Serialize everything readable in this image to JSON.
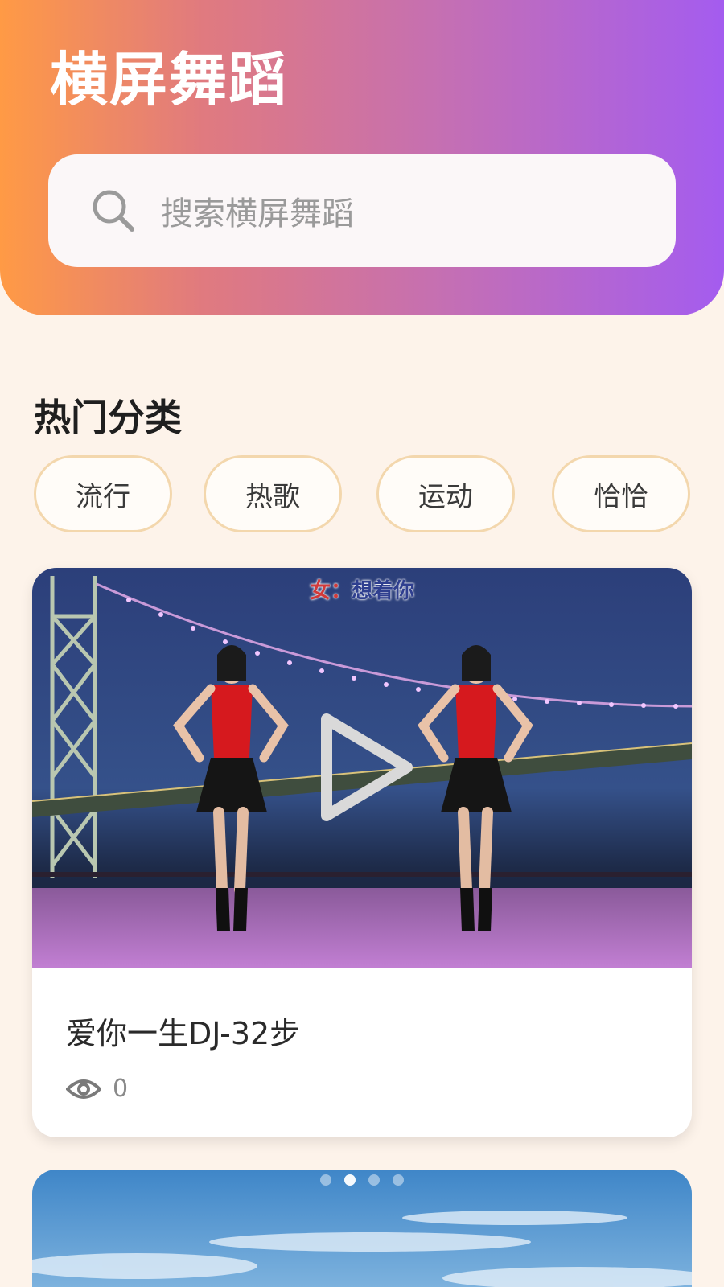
{
  "header": {
    "title": "横屏舞蹈",
    "search": {
      "placeholder": "搜索横屏舞蹈",
      "icon": "search-icon"
    },
    "gradient": [
      "#ff9a45",
      "#e07a7f",
      "#c46fb4",
      "#a45cef"
    ]
  },
  "categories": {
    "title": "热门分类",
    "items": [
      {
        "label": "流行"
      },
      {
        "label": "热歌"
      },
      {
        "label": "运动"
      },
      {
        "label": "恰恰"
      }
    ]
  },
  "videos": [
    {
      "title": "爱你一生DJ-32步",
      "views": "0",
      "subtitle_speaker": "女：",
      "subtitle_text": "想着你"
    }
  ],
  "carousel": {
    "count": 4,
    "active_index": 1
  },
  "colors": {
    "background": "#fdf3ea",
    "chip_border": "#f3d7ad",
    "accent_orange": "#ff9a45",
    "accent_purple": "#a45cef"
  }
}
